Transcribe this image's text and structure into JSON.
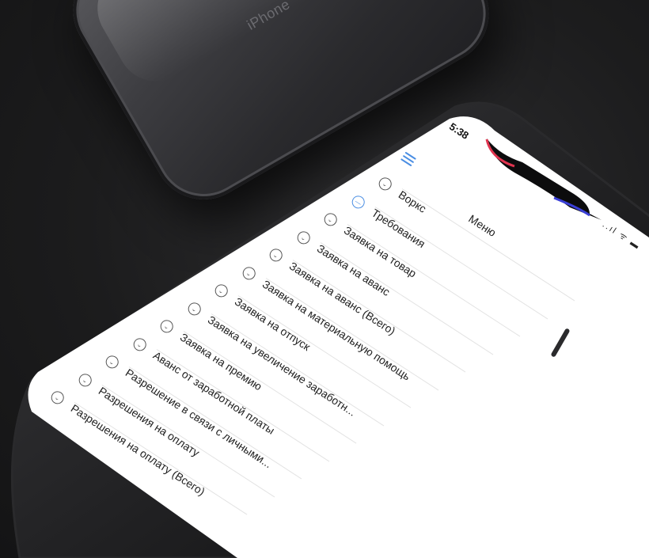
{
  "back_phone": {
    "brand": "iPhone"
  },
  "status_bar": {
    "time": "5:38",
    "icons": "..ıl ᯤ ▬"
  },
  "header": {
    "title": "Меню",
    "menu_icon": "hamburger-menu-icon"
  },
  "menu": {
    "items": [
      {
        "label": "Воркс",
        "icon": "chevron-circle-icon"
      },
      {
        "label": "Требования",
        "icon": "minus-circle-icon"
      },
      {
        "label": "Заявка на товар",
        "icon": "chevron-circle-icon"
      },
      {
        "label": "Заявка на аванс",
        "icon": "chevron-circle-icon"
      },
      {
        "label": "Заявка на аванс (Всего)",
        "icon": "chevron-circle-icon"
      },
      {
        "label": "Заявка на материальную помощь",
        "icon": "chevron-circle-icon"
      },
      {
        "label": "Заявка на отпуск",
        "icon": "chevron-circle-icon"
      },
      {
        "label": "Заявка на увеличение заработн...",
        "icon": "chevron-circle-icon"
      },
      {
        "label": "Заявка на премию",
        "icon": "chevron-circle-icon"
      },
      {
        "label": "Аванс от заработной платы",
        "icon": "chevron-circle-icon"
      },
      {
        "label": "Разрешение в связи с личными...",
        "icon": "chevron-circle-icon"
      },
      {
        "label": "Разрешения на оплату",
        "icon": "chevron-circle-icon"
      },
      {
        "label": "Разрешения на оплату (Всего)",
        "icon": "chevron-circle-icon"
      }
    ]
  },
  "colors": {
    "accent": "#4a8ee3",
    "notch_edge": "#e0344f"
  }
}
